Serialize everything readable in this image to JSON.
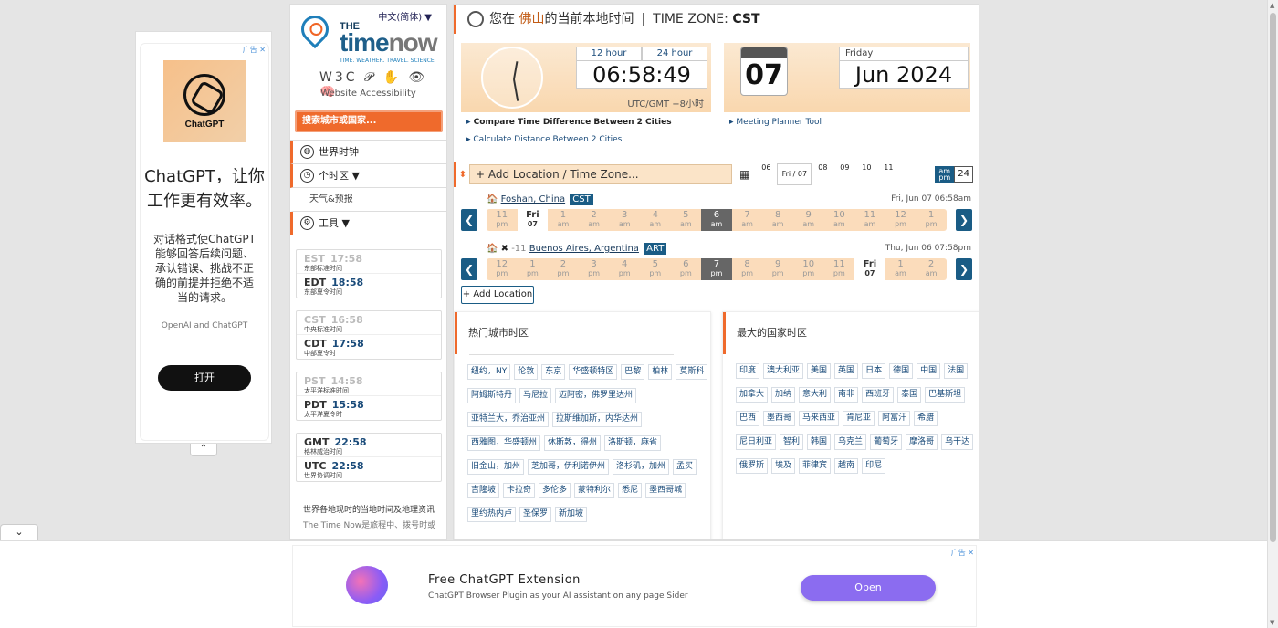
{
  "ad_left": {
    "marker": "广告 ✕",
    "image_label": "ChatGPT",
    "headline": "ChatGPT，让你工作更有效率。",
    "description": "对话格式使ChatGPT能够回答后续问题、承认错误、挑战不正确的前提并拒绝不适当的请求。",
    "source": "OpenAI and ChatGPT",
    "button": "打开",
    "collapse": "⌃"
  },
  "sidebar": {
    "language": "中文(简体) ▼",
    "logo": {
      "the": "THE",
      "time": "time",
      "now": "now",
      "tagline": "TIME. WEATHER. TRAVEL. SCIENCE."
    },
    "accessibility_icons": "W3C 𝒫 ✋ 👁 🧠",
    "accessibility_label": "Website Accessibility",
    "search_label": "搜索城市或国家...",
    "menu": [
      {
        "icon": "globe-icon",
        "label": "世界时钟"
      },
      {
        "icon": "clock-icon",
        "label": "个时区 ▼"
      },
      {
        "icon": "",
        "label": "天气&预报"
      },
      {
        "icon": "gear-icon",
        "label": "工具 ▼"
      }
    ],
    "zones": [
      [
        {
          "abbr": "EST",
          "time": "17:58",
          "name": "东部标准时间",
          "dim": true
        },
        {
          "abbr": "EDT",
          "time": "18:58",
          "name": "东部夏令时间",
          "dim": false
        }
      ],
      [
        {
          "abbr": "CST",
          "time": "16:58",
          "name": "中央标准时间",
          "dim": true
        },
        {
          "abbr": "CDT",
          "time": "17:58",
          "name": "中部夏令时",
          "dim": false
        }
      ],
      [
        {
          "abbr": "PST",
          "time": "14:58",
          "name": "太平洋标准时间",
          "dim": true
        },
        {
          "abbr": "PDT",
          "time": "15:58",
          "name": "太平洋夏令时",
          "dim": false
        }
      ],
      [
        {
          "abbr": "GMT",
          "time": "22:58",
          "name": "格林威治时间",
          "dim": false
        },
        {
          "abbr": "UTC",
          "time": "22:58",
          "name": "世界协调时间",
          "dim": false
        }
      ]
    ],
    "footer_title": "世界各地现时的当地时间及地理资讯",
    "footer_sub": "The Time Now是旅程中、拨号时或"
  },
  "main": {
    "heading": {
      "prefix": "您在",
      "city": "佛山",
      "suffix": "的当前本地时间",
      "tz_label": "TIME ZONE:",
      "tz": "CST"
    },
    "clock": {
      "tab12": "12 hour",
      "tab24": "24 hour",
      "time": "06:58:49",
      "utc": "UTC/GMT +8小时"
    },
    "date": {
      "day_num": "07",
      "weekday": "Friday",
      "date": "Jun 2024"
    },
    "links_left": [
      "Compare Time Difference Between 2 Cities",
      "Calculate Distance Between 2 Cities"
    ],
    "links_right": [
      "Meeting Planner Tool"
    ],
    "add_location_placeholder": "+ Add Location / Time Zone...",
    "date_strip": [
      "06",
      "Fri / 07",
      "08",
      "09",
      "10",
      "11"
    ],
    "ampm": {
      "am": "am",
      "pm": "pm",
      "h24": "24"
    },
    "cities": [
      {
        "icons": "🏠",
        "offset": "",
        "name": "Foshan, China",
        "badge": "CST",
        "stamp": "Fri, Jun 07 06:58am",
        "hours": [
          {
            "h": "11",
            "s": "pm",
            "type": ""
          },
          {
            "h": "Fri",
            "s": "07",
            "type": "day"
          },
          {
            "h": "1",
            "s": "am",
            "type": ""
          },
          {
            "h": "2",
            "s": "am",
            "type": ""
          },
          {
            "h": "3",
            "s": "am",
            "type": ""
          },
          {
            "h": "4",
            "s": "am",
            "type": ""
          },
          {
            "h": "5",
            "s": "am",
            "type": ""
          },
          {
            "h": "6",
            "s": "am",
            "type": "cur"
          },
          {
            "h": "7",
            "s": "am",
            "type": ""
          },
          {
            "h": "8",
            "s": "am",
            "type": ""
          },
          {
            "h": "9",
            "s": "am",
            "type": ""
          },
          {
            "h": "10",
            "s": "am",
            "type": ""
          },
          {
            "h": "11",
            "s": "am",
            "type": ""
          },
          {
            "h": "12",
            "s": "pm",
            "type": ""
          },
          {
            "h": "1",
            "s": "pm",
            "type": ""
          }
        ]
      },
      {
        "icons": "🏠 ✖",
        "offset": "-11",
        "name": "Buenos Aires, Argentina",
        "badge": "ART",
        "stamp": "Thu, Jun 06 07:58pm",
        "hours": [
          {
            "h": "12",
            "s": "pm",
            "type": ""
          },
          {
            "h": "1",
            "s": "pm",
            "type": ""
          },
          {
            "h": "2",
            "s": "pm",
            "type": ""
          },
          {
            "h": "3",
            "s": "pm",
            "type": ""
          },
          {
            "h": "4",
            "s": "pm",
            "type": ""
          },
          {
            "h": "5",
            "s": "pm",
            "type": ""
          },
          {
            "h": "6",
            "s": "pm",
            "type": ""
          },
          {
            "h": "7",
            "s": "pm",
            "type": "cur"
          },
          {
            "h": "8",
            "s": "pm",
            "type": ""
          },
          {
            "h": "9",
            "s": "pm",
            "type": ""
          },
          {
            "h": "10",
            "s": "pm",
            "type": ""
          },
          {
            "h": "11",
            "s": "pm",
            "type": ""
          },
          {
            "h": "Fri",
            "s": "07",
            "type": "day"
          },
          {
            "h": "1",
            "s": "am",
            "type": ""
          },
          {
            "h": "2",
            "s": "am",
            "type": ""
          }
        ]
      }
    ],
    "add_location_button": "+ Add Location",
    "popular_title": "热门城市时区",
    "popular_cities": [
      "纽约，NY",
      "伦敦",
      "东京",
      "华盛顿特区",
      "巴黎",
      "柏林",
      "莫斯科",
      "阿姆斯特丹",
      "马尼拉",
      "迈阿密，佛罗里达州",
      "亚特兰大，乔治亚州",
      "拉斯维加斯，内华达州",
      "西雅图，华盛顿州",
      "休斯敦，得州",
      "洛斯顿，麻省",
      "旧金山，加州",
      "芝加哥，伊利诺伊州",
      "洛杉矶，加州",
      "孟买",
      "吉隆坡",
      "卡拉奇",
      "多伦多",
      "蒙特利尔",
      "悉尼",
      "墨西哥城",
      "里约热内卢",
      "圣保罗",
      "新加坡"
    ],
    "countries_title": "最大的国家时区",
    "countries": [
      "印度",
      "澳大利亚",
      "美国",
      "英国",
      "日本",
      "德国",
      "中国",
      "法国",
      "加拿大",
      "加纳",
      "意大利",
      "南非",
      "西班牙",
      "泰国",
      "巴基斯坦",
      "巴西",
      "墨西哥",
      "马来西亚",
      "肯尼亚",
      "阿富汗",
      "希腊",
      "尼日利亚",
      "智利",
      "韩国",
      "乌克兰",
      "葡萄牙",
      "摩洛哥",
      "乌干达",
      "俄罗斯",
      "埃及",
      "菲律宾",
      "越南",
      "印尼"
    ]
  },
  "ad_bottom": {
    "marker": "广告 ✕",
    "title": "Free ChatGPT Extension",
    "subtitle": "ChatGPT Browser Plugin as your AI assistant on any page Sider",
    "button": "Open",
    "collapse": "⌄"
  }
}
